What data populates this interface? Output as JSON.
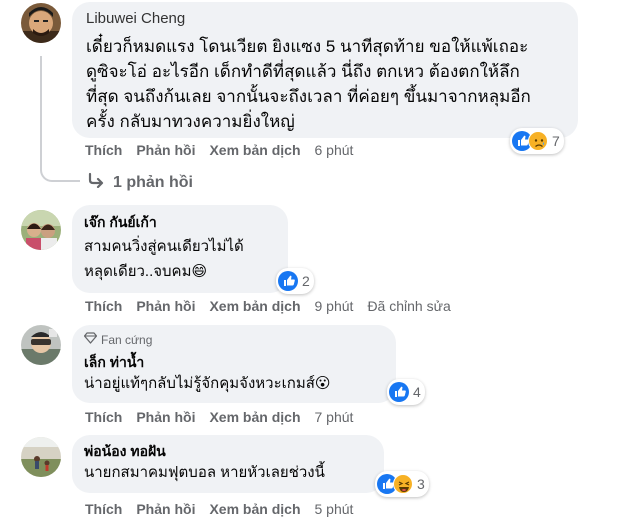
{
  "actions": {
    "like": "Thích",
    "reply": "Phản hồi",
    "translate": "Xem bản dịch"
  },
  "comments": [
    {
      "author": "Libuwei Cheng",
      "text": "เดี๋ยวก็หมดแรง โดนเวียต ยิงแซง 5 นาทีสุดท้าย ขอให้แพ้เถอะ\nดูซิจะโอ่ อะไรอีก เด็กทำดีที่สุดแล้ว นี่ถึง ตกเหว ต้องตกให้ลึก\nที่สุด จนถึงก้นเลย จากนั้นจะถึงเวลา ที่ค่อยๆ ขึ้นมาจากหลุมอีก\nครั้ง กลับมาทวงความยิ่งใหญ่",
      "reactions": {
        "icons": [
          "like-icon",
          "sad-icon"
        ],
        "count": "7"
      },
      "time": "6 phút",
      "replies": "1 phản hồi"
    },
    {
      "author": "เจ๊ก กันย์เก้า",
      "text": "สามคนวิ่งสู่คนเดียวไม่ได้\nหลุดเดียว..จบคม😄",
      "reactions": {
        "icons": [
          "like-icon"
        ],
        "count": "2"
      },
      "time": "9 phút",
      "edited": "Đã chỉnh sửa"
    },
    {
      "badge": "Fan cứng",
      "author": "เล็ก ท่าน้ำ",
      "text": "น่าอยู่แท้ๆกลับไม่รู้จักคุมจังหวะเกมส์😮",
      "reactions": {
        "icons": [
          "like-icon"
        ],
        "count": "4"
      },
      "time": "7 phút"
    },
    {
      "author": "พ่อน้อง ทอฝัน",
      "text": "นายกสมาคมฟุตบอล หายหัวเลยช่วงนี้",
      "reactions": {
        "icons": [
          "like-icon",
          "laugh-icon"
        ],
        "count": "3"
      },
      "time": "5 phút"
    }
  ],
  "colors": {
    "bubble": "#f0f2f5",
    "like": "#1877f2",
    "secondary_text": "#65676b",
    "thread_line": "#ced0d4"
  }
}
